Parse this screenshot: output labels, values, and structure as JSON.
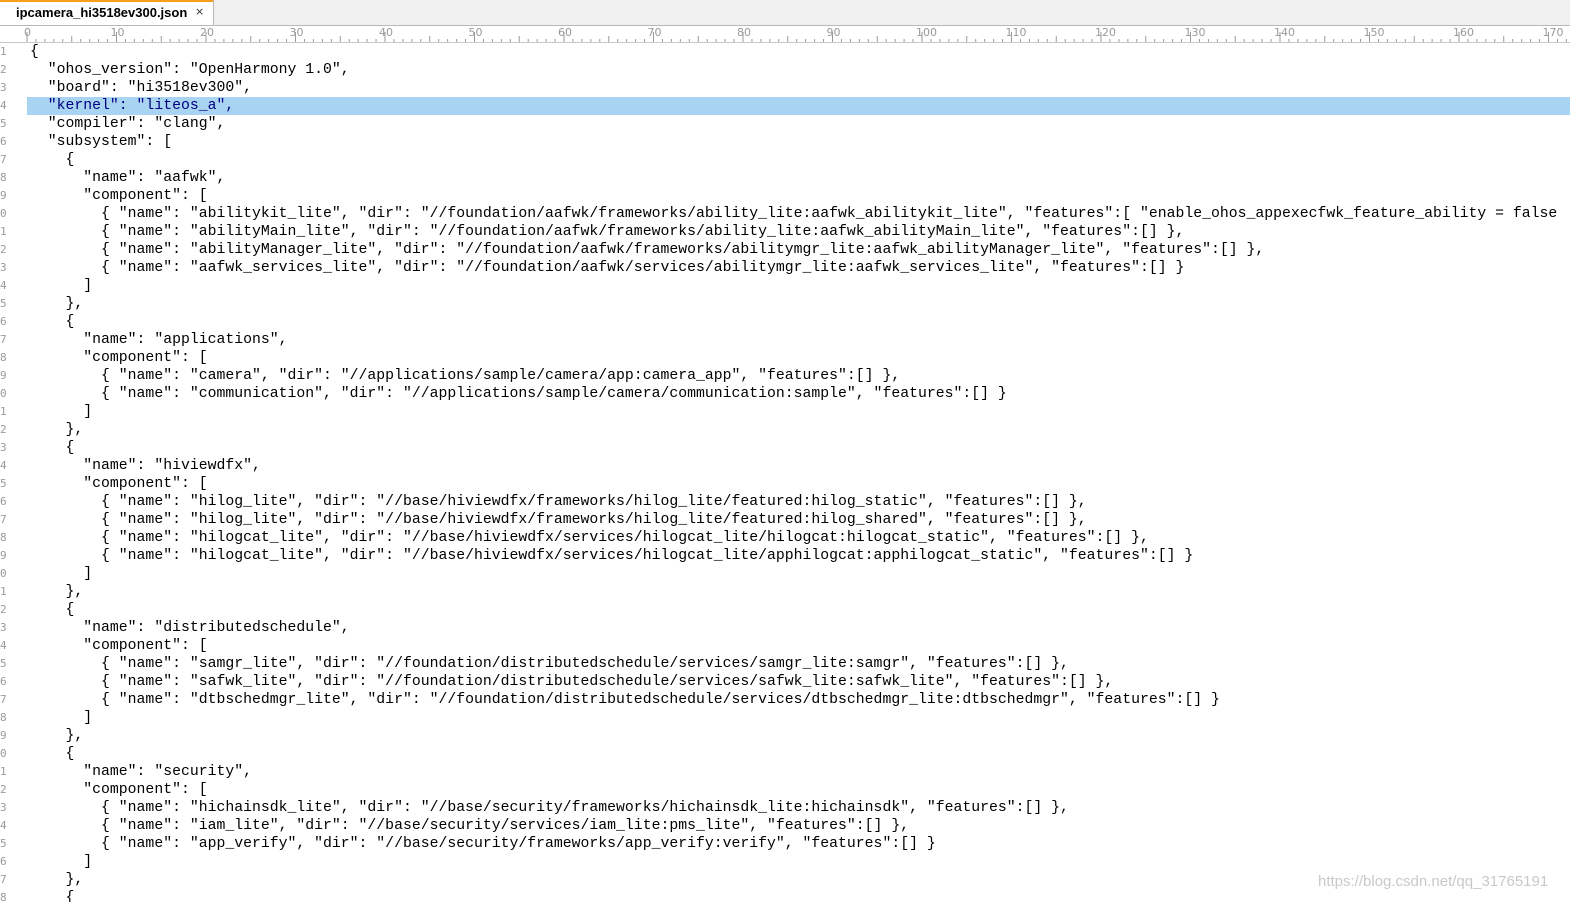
{
  "tab": {
    "title": "ipcamera_hi3518ev300.json",
    "close_glyph": "×"
  },
  "ruler": {
    "labels": [
      "0",
      "10",
      "20",
      "30",
      "40",
      "50",
      "60",
      "70",
      "80",
      "90",
      "100",
      "110",
      "120",
      "130",
      "140",
      "150",
      "160",
      "170"
    ]
  },
  "editor": {
    "highlighted_line": 4,
    "highlight_color": "#a8d4f1",
    "line_numbers": [
      "1",
      "2",
      "3",
      "4",
      "5",
      "6",
      "7",
      "8",
      "9",
      "0",
      "1",
      "2",
      "3",
      "4",
      "5",
      "6",
      "7",
      "8",
      "9",
      "0",
      "1",
      "2",
      "3",
      "4",
      "5",
      "6",
      "7",
      "8",
      "9",
      "0",
      "1",
      "2",
      "3",
      "4",
      "5",
      "6",
      "7",
      "8",
      "9",
      "0",
      "1",
      "2",
      "3",
      "4",
      "5",
      "6",
      "7",
      "8"
    ],
    "lines": [
      "{",
      "  \"ohos_version\": \"OpenHarmony 1.0\",",
      "  \"board\": \"hi3518ev300\",",
      "  \"kernel\": \"liteos_a\",",
      "  \"compiler\": \"clang\",",
      "  \"subsystem\": [",
      "    {",
      "      \"name\": \"aafwk\",",
      "      \"component\": [",
      "        { \"name\": \"abilitykit_lite\", \"dir\": \"//foundation/aafwk/frameworks/ability_lite:aafwk_abilitykit_lite\", \"features\":[ \"enable_ohos_appexecfwk_feature_ability = false",
      "        { \"name\": \"abilityMain_lite\", \"dir\": \"//foundation/aafwk/frameworks/ability_lite:aafwk_abilityMain_lite\", \"features\":[] },",
      "        { \"name\": \"abilityManager_lite\", \"dir\": \"//foundation/aafwk/frameworks/abilitymgr_lite:aafwk_abilityManager_lite\", \"features\":[] },",
      "        { \"name\": \"aafwk_services_lite\", \"dir\": \"//foundation/aafwk/services/abilitymgr_lite:aafwk_services_lite\", \"features\":[] }",
      "      ]",
      "    },",
      "    {",
      "      \"name\": \"applications\",",
      "      \"component\": [",
      "        { \"name\": \"camera\", \"dir\": \"//applications/sample/camera/app:camera_app\", \"features\":[] },",
      "        { \"name\": \"communication\", \"dir\": \"//applications/sample/camera/communication:sample\", \"features\":[] }",
      "      ]",
      "    },",
      "    {",
      "      \"name\": \"hiviewdfx\",",
      "      \"component\": [",
      "        { \"name\": \"hilog_lite\", \"dir\": \"//base/hiviewdfx/frameworks/hilog_lite/featured:hilog_static\", \"features\":[] },",
      "        { \"name\": \"hilog_lite\", \"dir\": \"//base/hiviewdfx/frameworks/hilog_lite/featured:hilog_shared\", \"features\":[] },",
      "        { \"name\": \"hilogcat_lite\", \"dir\": \"//base/hiviewdfx/services/hilogcat_lite/hilogcat:hilogcat_static\", \"features\":[] },",
      "        { \"name\": \"hilogcat_lite\", \"dir\": \"//base/hiviewdfx/services/hilogcat_lite/apphilogcat:apphilogcat_static\", \"features\":[] }",
      "      ]",
      "    },",
      "    {",
      "      \"name\": \"distributedschedule\",",
      "      \"component\": [",
      "        { \"name\": \"samgr_lite\", \"dir\": \"//foundation/distributedschedule/services/samgr_lite:samgr\", \"features\":[] },",
      "        { \"name\": \"safwk_lite\", \"dir\": \"//foundation/distributedschedule/services/safwk_lite:safwk_lite\", \"features\":[] },",
      "        { \"name\": \"dtbschedmgr_lite\", \"dir\": \"//foundation/distributedschedule/services/dtbschedmgr_lite:dtbschedmgr\", \"features\":[] }",
      "      ]",
      "    },",
      "    {",
      "      \"name\": \"security\",",
      "      \"component\": [",
      "        { \"name\": \"hichainsdk_lite\", \"dir\": \"//base/security/frameworks/hichainsdk_lite:hichainsdk\", \"features\":[] },",
      "        { \"name\": \"iam_lite\", \"dir\": \"//base/security/services/iam_lite:pms_lite\", \"features\":[] },",
      "        { \"name\": \"app_verify\", \"dir\": \"//base/security/frameworks/app_verify:verify\", \"features\":[] }",
      "      ]",
      "    },",
      "    {"
    ]
  },
  "watermark": "https://blog.csdn.net/qq_31765191"
}
